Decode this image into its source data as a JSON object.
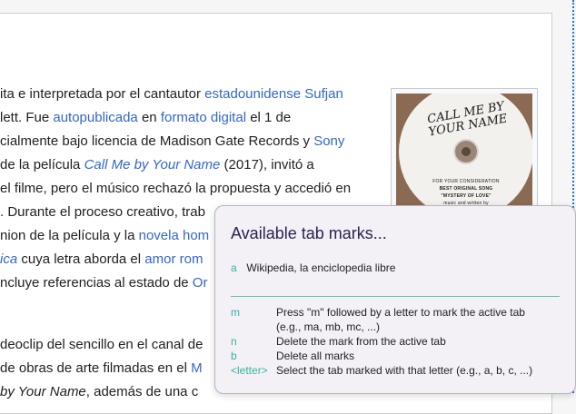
{
  "article": {
    "paragraph1": [
      [
        {
          "t": "ita e interpretada por el cantautor "
        },
        {
          "t": "estadounidense",
          "c": "link"
        },
        {
          "t": " "
        },
        {
          "t": "Sufjan",
          "c": "link"
        }
      ],
      [
        {
          "t": "lett. Fue "
        },
        {
          "t": "autopublicada",
          "c": "link"
        },
        {
          "t": " en "
        },
        {
          "t": "formato digital",
          "c": "link"
        },
        {
          "t": " el 1 de"
        }
      ],
      [
        {
          "t": "cialmente bajo licencia de Madison Gate Records y "
        },
        {
          "t": "Sony",
          "c": "link"
        }
      ],
      [
        {
          "t": "de la película "
        },
        {
          "t": "Call Me by Your Name",
          "c": "link ital"
        },
        {
          "t": " (2017), invitó a"
        }
      ],
      [
        {
          "t": "el filme, pero el músico rechazó la propuesta y accedió en"
        }
      ],
      [
        {
          "t": ". Durante el proceso creativo, trab"
        }
      ],
      [
        {
          "t": "nion de la película y la "
        },
        {
          "t": "novela hom",
          "c": "link"
        }
      ],
      [
        {
          "t": "ica",
          "c": "link ital"
        },
        {
          "t": " cuya letra aborda el "
        },
        {
          "t": "amor rom",
          "c": "link"
        }
      ],
      [
        {
          "t": "ncluye referencias al estado de "
        },
        {
          "t": "Or",
          "c": "link"
        }
      ]
    ],
    "paragraph2": [
      [
        {
          "t": "deoclip del sencillo en el canal de"
        }
      ],
      [
        {
          "t": "de obras de arte filmadas en el "
        },
        {
          "t": "M",
          "c": "link"
        }
      ],
      [
        {
          "t": "by Your Name",
          "c": "ital"
        },
        {
          "t": ", además de una c"
        }
      ]
    ]
  },
  "album": {
    "title_line1": "CALL ME BY",
    "title_line2": "YOUR NAME",
    "consideration": "FOR YOUR CONSIDERATION",
    "category": "BEST ORIGINAL SONG",
    "song": "\"MYSTERY OF LOVE\"",
    "credit": "music and written by"
  },
  "popup": {
    "title": "Available tab marks...",
    "mark": {
      "key": "a",
      "label": "Wikipedia, la enciclopedia libre"
    },
    "help": [
      {
        "key": "m",
        "desc": "Press \"m\" followed by a letter to mark the active tab"
      },
      {
        "key": "",
        "desc": "(e.g., ma, mb, mc, ...)"
      },
      {
        "key": "n",
        "desc": "Delete the mark from the active tab"
      },
      {
        "key": "b",
        "desc": "Delete all marks"
      },
      {
        "key": "<letter>",
        "desc": "Select the tab marked with that letter (e.g., a, b, c, ...)"
      }
    ]
  }
}
